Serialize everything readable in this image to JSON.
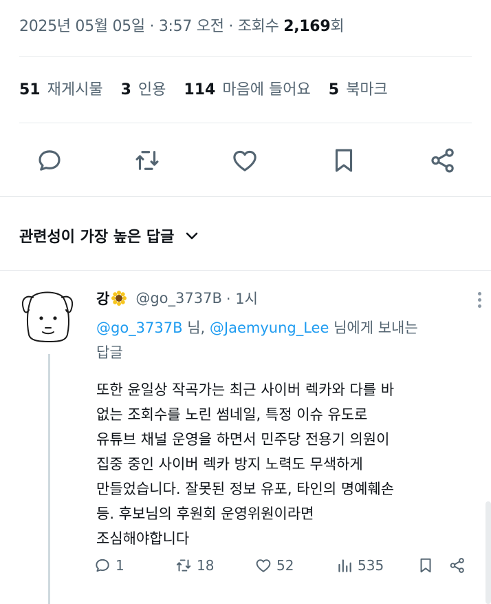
{
  "tweet": {
    "timestamp_text": "2025년 05월 05일 · 3:57 오전 · 조회수 ",
    "views": "2,169",
    "views_suffix": "회"
  },
  "stats": [
    {
      "count": "51",
      "label": "재게시물"
    },
    {
      "count": "3",
      "label": "인용"
    },
    {
      "count": "114",
      "label": "마음에 들어요"
    },
    {
      "count": "5",
      "label": "북마크"
    }
  ],
  "actions": {
    "icons": [
      "reply-icon",
      "retweet-icon",
      "like-icon",
      "bookmark-icon",
      "share-icon"
    ]
  },
  "sort": {
    "label": "관련성이 가장 높은 답글"
  },
  "reply": {
    "name": "강",
    "emoji": "sunflower",
    "handle": "@go_3737B",
    "time": "· 1시",
    "replying_to": {
      "mention1": "@go_3737B",
      "sep1": " 님, ",
      "mention2": "@Jaemyung_Lee",
      "suffix": " 님에게 보내는",
      "line2": "답글"
    },
    "body_lines": [
      "또한 윤일상 작곡가는 최근 사이버 렉카와 다를 바",
      "없는 조회수를 노린 썸네일, 특정 이슈 유도로",
      "유튜브 채널 운영을 하면서 민주당 전용기 의원이",
      "집중 중인 사이버 렉카 방지 노력도 무색하게",
      "만들었습니다. 잘못된 정보 유포, 타인의 명예훼손",
      "등. 후보님의 후원회 운영위원이라면",
      "조심해야합니다"
    ],
    "counts": {
      "replies": "1",
      "retweets": "18",
      "likes": "52",
      "views": "535"
    }
  },
  "colors": {
    "text": "#0f1419",
    "secondary": "#536471",
    "link": "#1d9bf0",
    "divider": "#e6e9ec"
  }
}
